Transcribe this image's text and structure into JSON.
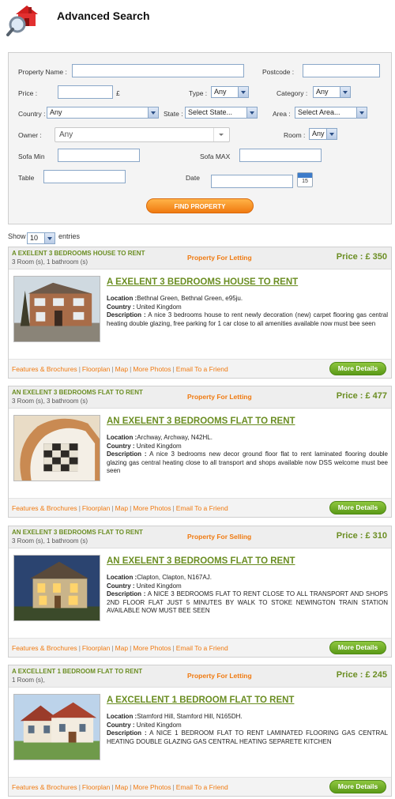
{
  "header": {
    "title": "Advanced Search",
    "icon": "house-search-icon"
  },
  "form": {
    "property_name_label": "Property Name :",
    "postcode_label": "Postcode :",
    "price_label": "Price :",
    "currency_symbol": "£",
    "type_label": "Type :",
    "type_value": "Any",
    "category_label": "Category :",
    "category_value": "Any",
    "country_label": "Country :",
    "country_value": "Any",
    "state_label": "State :",
    "state_value": "Select State...",
    "area_label": "Area :",
    "area_value": "Select Area...",
    "owner_label": "Owner :",
    "owner_value": "Any",
    "room_label": "Room :",
    "room_value": "Any",
    "sofa_min_label": "Sofa Min",
    "sofa_max_label": "Sofa MAX",
    "table_label": "Table",
    "date_label": "Date",
    "calendar_day": "15",
    "find_button": "FIND PROPERTY"
  },
  "entries": {
    "show_label": "Show",
    "value": "10",
    "suffix": "entries"
  },
  "listings": [
    {
      "title_caps": "A EXELENT 3 BEDROOMS HOUSE TO RENT",
      "rooms": "3 Room (s), 1 bathroom (s)",
      "type": "Property For Letting",
      "price": "Price : £ 350",
      "link": "A EXELENT 3 BEDROOMS HOUSE TO RENT",
      "location_label": "Location :",
      "location": "Bethnal Green, Bethnal Green, e95ju.",
      "country_label": "Country :",
      "country": "United Kingdom",
      "description_label": "Description :",
      "description": "A nice 3 bedrooms house to rent newly decoration (new) carpet flooring gas central heating double glazing, free parking for 1 car close to all amenities available now must bee seen",
      "photo": "brick-house-photo"
    },
    {
      "title_caps": "AN EXELENT 3 BEDROOMS FLAT TO RENT",
      "rooms": "3 Room (s), 3 bathroom (s)",
      "type": "Property For Letting",
      "price": "Price : £ 477",
      "link": "AN EXELENT 3 BEDROOMS FLAT TO RENT",
      "location_label": "Location :",
      "location": "Archway, Archway, N42HL.",
      "country_label": "Country :",
      "country": "United Kingdom",
      "description_label": "Description :",
      "description": "A nice 3 bedrooms new decor ground floor flat to rent laminated flooring double glazing gas central heating close to all transport and shops available now DSS welcome must bee seen",
      "photo": "staircase-photo"
    },
    {
      "title_caps": "AN EXELENT 3 BEDROOMS FLAT TO RENT",
      "rooms": "3 Room (s), 1 bathroom (s)",
      "type": "Property For Selling",
      "price": "Price : £ 310",
      "link": "AN EXELENT 3 BEDROOMS FLAT TO RENT",
      "location_label": "Location :",
      "location": "Clapton, Clapton, N167AJ.",
      "country_label": "Country :",
      "country": "United Kingdom",
      "description_label": "Description :",
      "description": "A NICE 3 BEDROOMS FLAT TO RENT CLOSE TO ALL TRANSPORT AND SHOPS 2ND FLOOR FLAT JUST 5 MINUTES BY WALK TO STOKE NEWINGTON TRAIN STATION AVAILABLE NOW MUST BEE SEEN",
      "photo": "night-house-photo"
    },
    {
      "title_caps": "A EXCELLENT 1 BEDROOM FLAT TO RENT",
      "rooms": "1 Room (s),",
      "type": "Property For Letting",
      "price": "Price : £ 245",
      "link": "A EXCELLENT 1 BEDROOM FLAT TO RENT",
      "location_label": "Location :",
      "location": "Stamford Hill, Stamford Hill, N165DH.",
      "country_label": "Country :",
      "country": "United Kingdom",
      "description_label": "Description :",
      "description": "A NICE 1 BEDROOM FLAT TO RENT LAMINATED FLOORING GAS CENTRAL HEATING DOUBLE GLAZING GAS CENTRAL HEATING SEPARETE KITCHEN",
      "photo": "villa-photo"
    }
  ],
  "card_tools": [
    "Features & Brochures",
    "Floorplan",
    "Map",
    "More Photos",
    "Email To a Friend"
  ],
  "more_details_label": "More Details",
  "colors": {
    "accent_green": "#6b8e23",
    "accent_orange": "#f07a10"
  }
}
